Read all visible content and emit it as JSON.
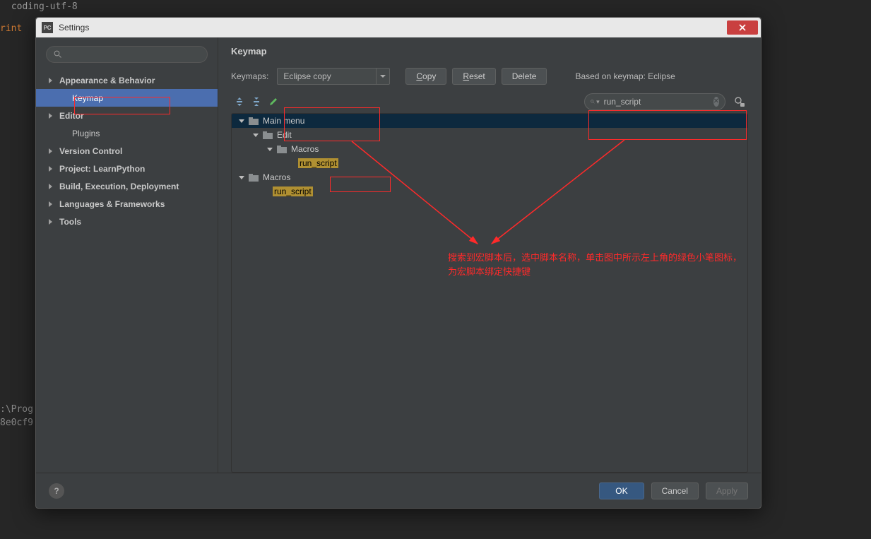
{
  "window": {
    "title": "Settings",
    "app_icon_text": "PC"
  },
  "bg": {
    "line1": " coding-utf-8",
    "line2": "rint",
    "bottom1": ":\\Prog",
    "bottom2": "8e0cf9"
  },
  "sidebar": {
    "search_placeholder": "",
    "items": [
      {
        "label": "Appearance & Behavior",
        "sub": false
      },
      {
        "label": "Keymap",
        "sub": true,
        "selected": true
      },
      {
        "label": "Editor",
        "sub": false
      },
      {
        "label": "Plugins",
        "sub": true
      },
      {
        "label": "Version Control",
        "sub": false
      },
      {
        "label": "Project: LearnPython",
        "sub": false
      },
      {
        "label": "Build, Execution, Deployment",
        "sub": false
      },
      {
        "label": "Languages & Frameworks",
        "sub": false
      },
      {
        "label": "Tools",
        "sub": false
      }
    ]
  },
  "content": {
    "title": "Keymap",
    "keymaps_label": "Keymaps:",
    "keymaps_value": "Eclipse copy",
    "buttons": {
      "copy": "Copy",
      "reset": "Reset",
      "delete": "Delete"
    },
    "based_on_label": "Based on keymap: Eclipse",
    "search_value": "run_script",
    "tree": {
      "main_menu": "Main menu",
      "edit": "Edit",
      "macros": "Macros",
      "run_script1": "run_script",
      "macros2": "Macros",
      "run_script2": "run_script"
    }
  },
  "footer": {
    "ok": "OK",
    "cancel": "Cancel",
    "apply": "Apply",
    "help": "?"
  },
  "annotation": {
    "text": "搜索到宏脚本后，选中脚本名称，单击图中所示左上角的绿色小笔图标，为宏脚本绑定快捷键"
  }
}
